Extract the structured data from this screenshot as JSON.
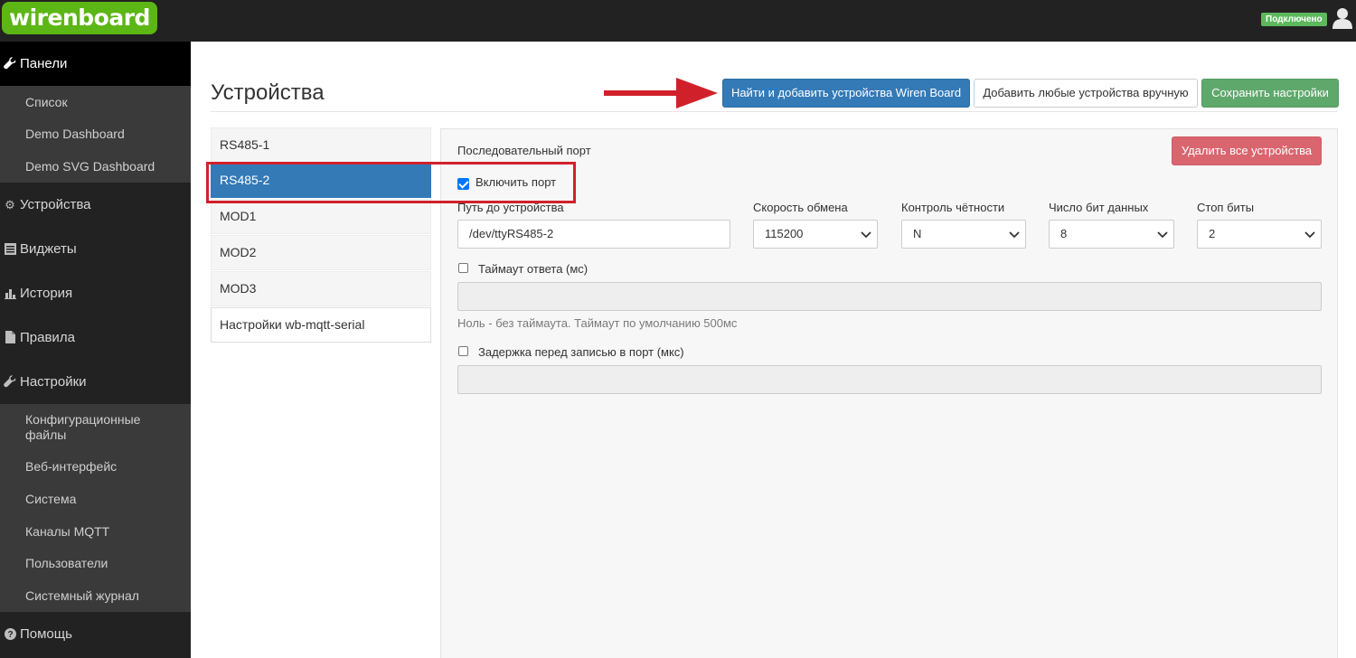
{
  "header": {
    "logo_text": "wirenboard",
    "status_badge": "Подключено",
    "user_icon": "user-icon"
  },
  "sidebar": {
    "panels": {
      "label": "Панели",
      "icon": "wrench-icon"
    },
    "panels_sub": [
      "Список",
      "Demo Dashboard",
      "Demo SVG Dashboard"
    ],
    "devices": {
      "label": "Устройства",
      "icon": "gear-icon"
    },
    "widgets": {
      "label": "Виджеты",
      "icon": "list-icon"
    },
    "history": {
      "label": "История",
      "icon": "bar-chart-icon"
    },
    "rules": {
      "label": "Правила",
      "icon": "file-icon"
    },
    "settings": {
      "label": "Настройки",
      "icon": "wrench-icon"
    },
    "settings_sub": [
      "Конфигурационные файлы",
      "Веб-интерфейс",
      "Система",
      "Каналы MQTT",
      "Пользователи",
      "Системный журнал"
    ],
    "help": {
      "label": "Помощь",
      "icon": "question-icon"
    }
  },
  "main": {
    "title": "Устройства",
    "buttons": {
      "scan": "Найти и добавить устройства Wiren Board",
      "add_manual": "Добавить любые устройства вручную",
      "save": "Сохранить настройки"
    },
    "ports": [
      "RS485-1",
      "RS485-2",
      "MOD1",
      "MOD2",
      "MOD3",
      "Настройки wb-mqtt-serial"
    ],
    "active_port": "RS485-2"
  },
  "panel": {
    "section_title": "Последовательный порт",
    "delete_all": "Удалить все устройства",
    "enable_port": {
      "label": "Включить порт",
      "checked": true
    },
    "path": {
      "label": "Путь до устройства",
      "value": "/dev/ttyRS485-2"
    },
    "baud": {
      "label": "Скорость обмена",
      "value": "115200"
    },
    "parity": {
      "label": "Контроль чётности",
      "value": "N"
    },
    "data_bits": {
      "label": "Число бит данных",
      "value": "8"
    },
    "stop_bits": {
      "label": "Стоп биты",
      "value": "2"
    },
    "timeout": {
      "label": "Таймаут ответа (мс)",
      "checked": false,
      "value": "",
      "help": "Ноль - без таймаута. Таймаут по умолчанию 500мс"
    },
    "delay": {
      "label": "Задержка перед записью в порт (мкс)",
      "checked": false,
      "value": ""
    }
  },
  "colors": {
    "primary": "#337ab7",
    "success": "#5fa86b",
    "danger": "#d9656f",
    "logo_green": "#5cb615",
    "annotation_red": "#d0212b"
  }
}
